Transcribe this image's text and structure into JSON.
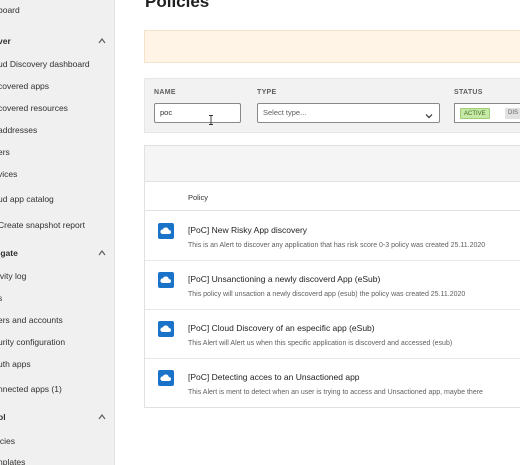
{
  "sidebar": {
    "items": [
      {
        "label": "board",
        "top": 0
      },
      {
        "label": "ver",
        "head": true
      },
      {
        "label": "ud Discovery dashboard"
      },
      {
        "label": "covered apps"
      },
      {
        "label": "covered resources"
      },
      {
        "label": "addresses"
      },
      {
        "label": "ers"
      },
      {
        "label": "vices"
      },
      {
        "label": "ud app catalog"
      },
      {
        "label": "Create snapshot report"
      },
      {
        "label": "igate",
        "head": true
      },
      {
        "label": "ivity log"
      },
      {
        "label": "s"
      },
      {
        "label": "ers and accounts"
      },
      {
        "label": "urity configuration"
      },
      {
        "label": "uth apps"
      },
      {
        "label": "nnected apps (1)"
      },
      {
        "label": "ol",
        "head": true
      },
      {
        "label": "icies"
      },
      {
        "label": "nplates"
      }
    ]
  },
  "main": {
    "title": "Policies",
    "filters": {
      "name_label": "NAME",
      "name_value": "poc",
      "type_label": "TYPE",
      "type_placeholder": "Select type...",
      "status_label": "STATUS",
      "status_active": "ACTIVE",
      "status_disabled": "DIS"
    },
    "table": {
      "column_policy": "Policy",
      "rows": [
        {
          "title": "[PoC] New Risky App discovery",
          "desc": "This is an Alert to discover any application that has risk score 0-3 policy was created 25.11.2020"
        },
        {
          "title": "[PoC] Unsanctioning a newly discoverd App (eSub)",
          "desc": "This policy will unsaction a newly discoverd app (esub) the policy was created 25.11.2020"
        },
        {
          "title": "[PoC] Cloud Discovery of an especific app (eSub)",
          "desc": "This Alert will Alert us when this specific application is discoverd and accessed (esub)"
        },
        {
          "title": "[PoC] Detecting acces to an Unsactioned app",
          "desc": "This Alert is ment to detect when an user is trying to access and Unsactioned app, maybe there"
        }
      ]
    }
  },
  "colors": {
    "accent": "#1a73c8",
    "active_pill": "#c8e8a8"
  },
  "icons": [
    "chevron-up-icon",
    "chevron-down-icon",
    "cloud-icon",
    "text-cursor-icon"
  ]
}
